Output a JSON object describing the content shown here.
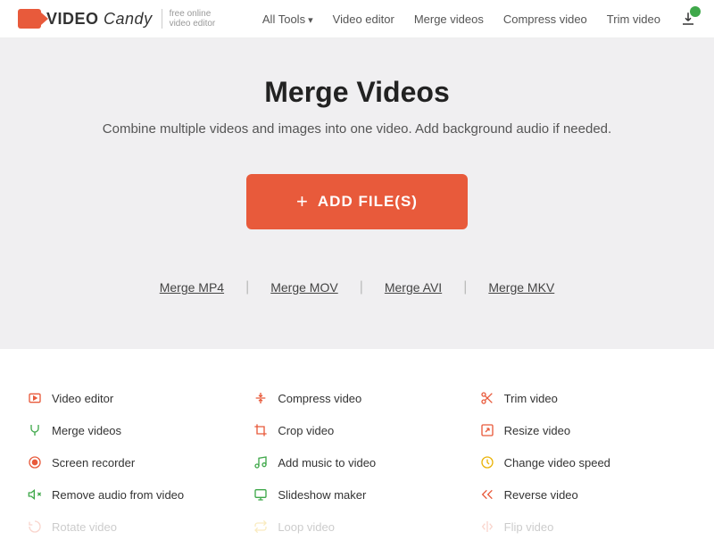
{
  "logo": {
    "text_bold": "VIDEO",
    "text_italic": "Candy",
    "tagline1": "free online",
    "tagline2": "video editor"
  },
  "nav": {
    "all_tools": "All Tools",
    "video_editor": "Video editor",
    "merge": "Merge videos",
    "compress": "Compress video",
    "trim": "Trim video"
  },
  "hero": {
    "title": "Merge Videos",
    "subtitle": "Combine multiple videos and images into one video. Add background audio if needed.",
    "button": "ADD FILE(S)"
  },
  "merge_links": {
    "mp4": "Merge MP4",
    "mov": "Merge MOV",
    "avi": "Merge AVI",
    "mkv": "Merge MKV"
  },
  "tools": {
    "col1": [
      {
        "label": "Video editor"
      },
      {
        "label": "Merge videos"
      },
      {
        "label": "Screen recorder"
      },
      {
        "label": "Remove audio from video"
      },
      {
        "label": "Rotate video"
      }
    ],
    "col2": [
      {
        "label": "Compress video"
      },
      {
        "label": "Crop video"
      },
      {
        "label": "Add music to video"
      },
      {
        "label": "Slideshow maker"
      },
      {
        "label": "Loop video"
      }
    ],
    "col3": [
      {
        "label": "Trim video"
      },
      {
        "label": "Resize video"
      },
      {
        "label": "Change video speed"
      },
      {
        "label": "Reverse video"
      },
      {
        "label": "Flip video"
      }
    ]
  }
}
